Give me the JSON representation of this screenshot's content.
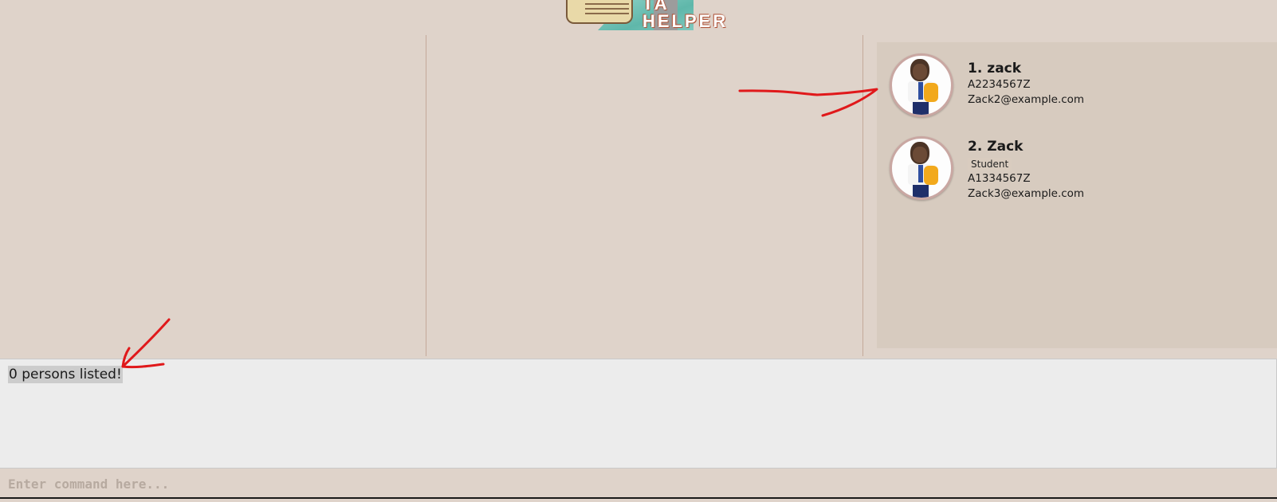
{
  "header": {
    "logo_title": "TA",
    "logo_subtitle": "HELPER"
  },
  "persons": [
    {
      "index": "1.",
      "name": "zack",
      "tags": [],
      "matric": "A2234567Z",
      "email": "Zack2@example.com"
    },
    {
      "index": "2.",
      "name": "Zack",
      "tags": [
        "Student"
      ],
      "matric": "A1334567Z",
      "email": "Zack3@example.com"
    }
  ],
  "result": {
    "text": "0 persons listed!"
  },
  "command": {
    "placeholder": "Enter command here...",
    "value": ""
  },
  "colors": {
    "background": "#dfd3ca",
    "panel": "#d7cbbf",
    "annotation": "#e0191b"
  },
  "icons": {
    "avatar": "student-avatar-icon"
  }
}
